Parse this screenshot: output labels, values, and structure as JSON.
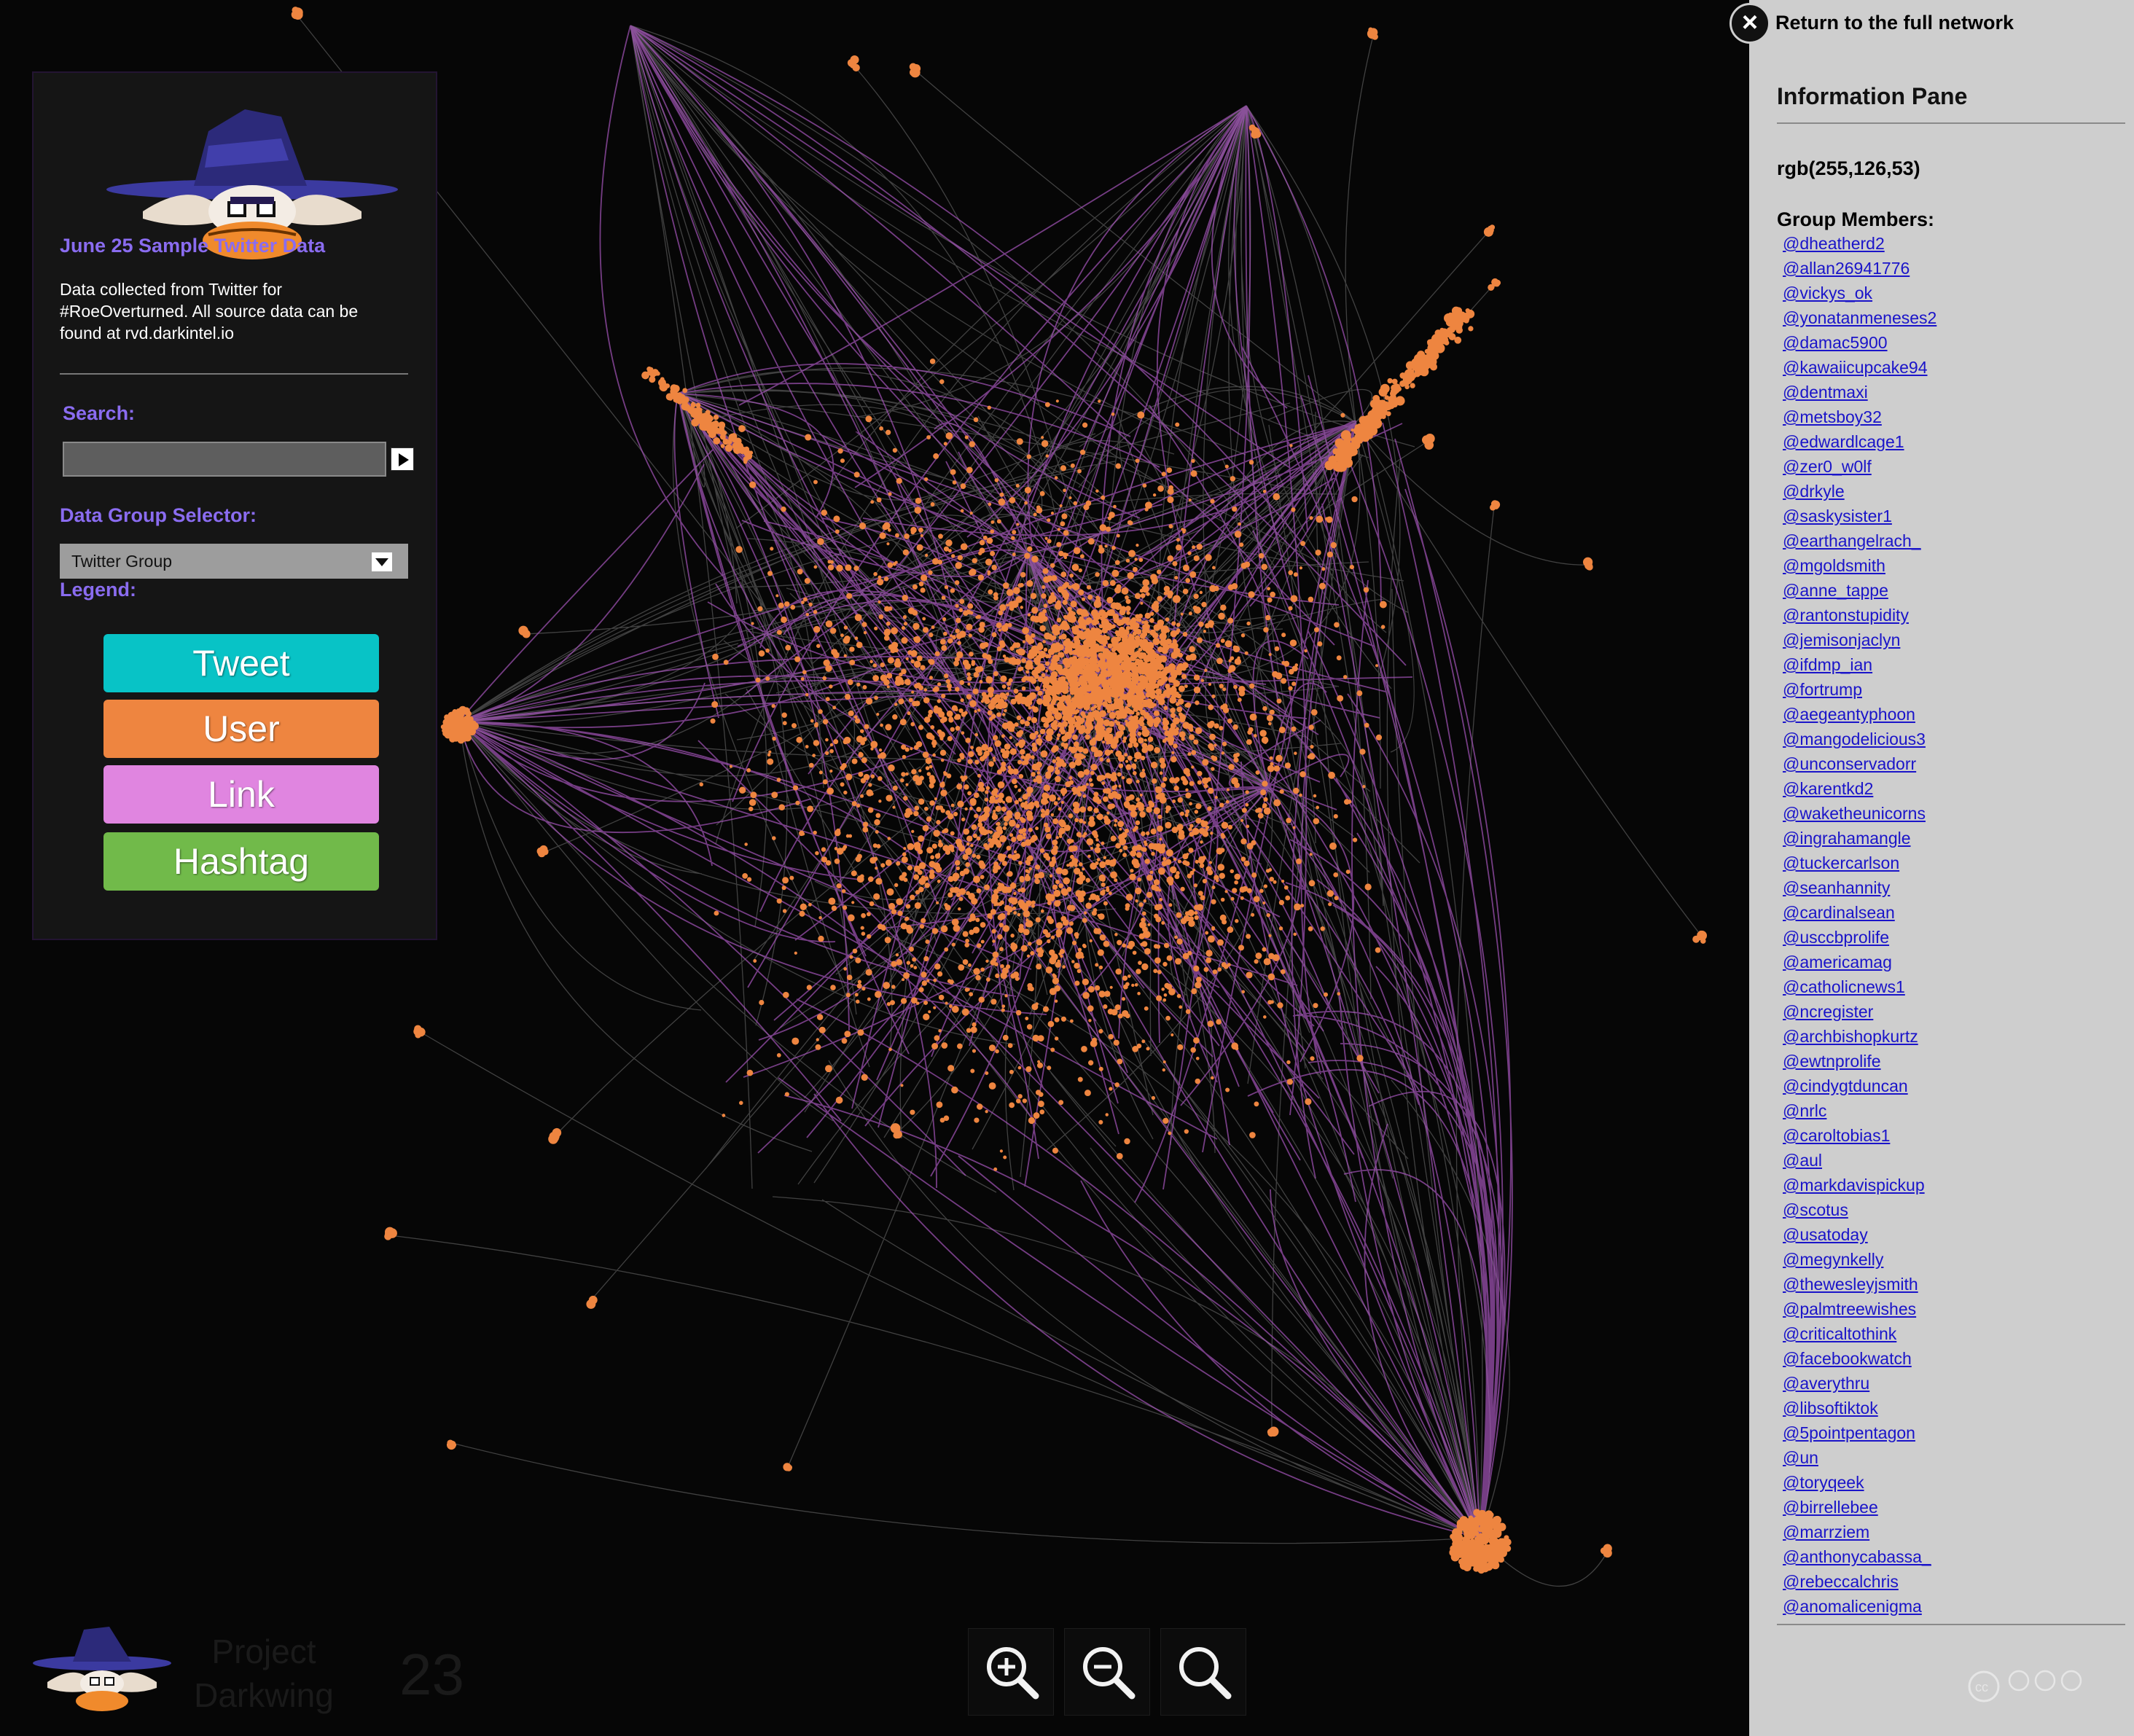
{
  "left_panel": {
    "title": "June 25 Sample Twitter Data",
    "description": "Data collected from Twitter for #RoeOverturned. All source data can be found at rvd.darkintel.io",
    "search_label": "Search:",
    "search_value": "",
    "group_selector_label": "Data Group Selector:",
    "group_selected": "Twitter Group",
    "legend_label": "Legend:",
    "legend": [
      {
        "label": "Tweet",
        "color": "#08c3c6"
      },
      {
        "label": "User",
        "color": "#ee8540"
      },
      {
        "label": "Link",
        "color": "#e085e0"
      },
      {
        "label": "Hashtag",
        "color": "#71ba4a"
      }
    ]
  },
  "branding": {
    "name": "Project Darkwing",
    "number": "23"
  },
  "zoom_controls": {
    "zoom_in_icon": "zoom-in-icon",
    "zoom_out_icon": "zoom-out-icon",
    "reset_icon": "search-icon"
  },
  "info_pane": {
    "return_label": "Return to the full network",
    "title": "Information Pane",
    "group_color": "rgb(255,126,53)",
    "members_label": "Group Members:",
    "members": [
      "@dheatherd2",
      "@allan26941776",
      "@vickys_ok",
      "@yonatanmeneses2",
      "@damac5900",
      "@kawaiicupcake94",
      "@dentmaxi",
      "@metsboy32",
      "@edwardlcage1",
      "@zer0_w0lf",
      "@drkyle",
      "@saskysister1",
      "@earthangelrach_",
      "@mgoldsmith",
      "@anne_tappe",
      "@rantonstupidity",
      "@jemisonjaclyn",
      "@ifdmp_ian",
      "@fortrump",
      "@aegeantyphoon",
      "@mangodelicious3",
      "@unconservadorr",
      "@karentkd2",
      "@waketheunicorns",
      "@ingrahamangle",
      "@tuckercarlson",
      "@seanhannity",
      "@cardinalsean",
      "@usccbprolife",
      "@americamag",
      "@catholicnews1",
      "@ncregister",
      "@archbishopkurtz",
      "@ewtnprolife",
      "@cindygtduncan",
      "@nrlc",
      "@caroltobias1",
      "@aul",
      "@markdavispickup",
      "@scotus",
      "@usatoday",
      "@megynkelly",
      "@thewesleyjsmith",
      "@palmtreewishes",
      "@criticaltothink",
      "@facebookwatch",
      "@averythru",
      "@libsoftiktok",
      "@5pointpentagon",
      "@un",
      "@toryqeek",
      "@birrellebee",
      "@marrziem",
      "@anthonycabassa_",
      "@rebeccalchris",
      "@anomalicenigma"
    ]
  },
  "colors": {
    "background": "#060606",
    "node": "#ee8540",
    "edge_link": "#b05bc8",
    "edge_grey": "#8a8a8a",
    "accent": "#8a6cf0",
    "pane_bg": "#cecece",
    "member_link": "#1a14c9"
  }
}
